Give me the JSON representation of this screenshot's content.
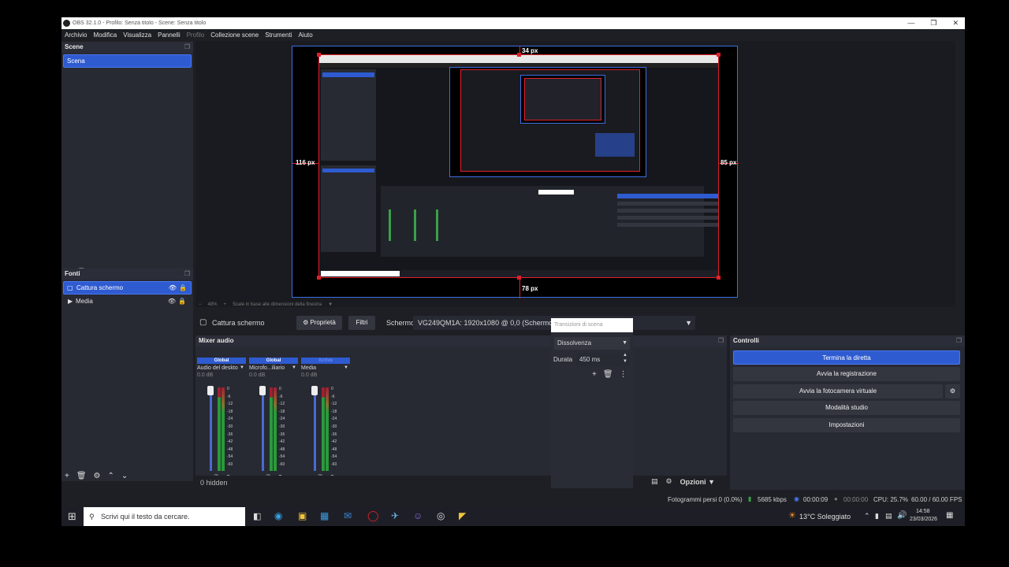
{
  "window": {
    "title": "OBS 32.1.0 - Profilo: Senza titolo - Scene: Senza titolo",
    "controls": [
      "minimize-icon",
      "restore-icon",
      "close-icon"
    ]
  },
  "menu": {
    "items": [
      "Archivio",
      "Modifica",
      "Visualizza",
      "Pannelli"
    ],
    "disabled": "Profilo",
    "items2": [
      "Collezione scene",
      "Strumenti",
      "Aiuto"
    ]
  },
  "scenes": {
    "title": "Scene",
    "items": [
      "Scena"
    ]
  },
  "sources": {
    "title": "Fonti",
    "items": [
      {
        "label": "Cattura schermo",
        "icon": "monitor-icon",
        "selected": true
      },
      {
        "label": "Media",
        "icon": "play-icon",
        "selected": false
      }
    ]
  },
  "preview": {
    "zoom": "48%",
    "scale_label": "Scale in base alle dimensioni della finestra",
    "px_top": "34 px",
    "px_left": "116 px",
    "px_right": "85 px",
    "px_bottom": "78 px"
  },
  "source_bar": {
    "source_name": "Cattura schermo",
    "properties": "Proprietà",
    "filters": "Filtri",
    "screen_label": "Schermo",
    "screen_value": "VG249QM1A: 1920x1080 @ 0,0 (Schermo princip"
  },
  "mixer": {
    "title": "Mixer audio",
    "hidden": "0 hidden",
    "channels": [
      {
        "tag": "Global",
        "name": "Audio del deskto",
        "db": "0.0 dB"
      },
      {
        "tag": "Global",
        "name": "Microfo...iliario",
        "db": "0.0 dB"
      },
      {
        "tag": "Active",
        "name": "Media",
        "db": "0.0 dB"
      }
    ],
    "scale": [
      "0",
      "-6",
      "-12",
      "-18",
      "-24",
      "-30",
      "-36",
      "-42",
      "-48",
      "-54",
      "-60"
    ]
  },
  "transitions": {
    "placeholder": "Transizioni di scena",
    "selected": "Dissolvenza",
    "duration_label": "Durata",
    "duration_value": "450 ms"
  },
  "bottom_toolbar": {
    "options": "Opzioni"
  },
  "controls": {
    "title": "Controlli",
    "stop_stream": "Termina la diretta",
    "start_recording": "Avvia la registrazione",
    "start_virtualcam": "Avvia la fotocamera virtuale",
    "studio_mode": "Modalità studio",
    "settings": "Impostazioni"
  },
  "status": {
    "dropped": "Fotogrammi persi 0 (0.0%)",
    "bitrate": "5685 kbps",
    "stream_time": "00:00:09",
    "rec_time": "00:00:00",
    "cpu": "CPU: 25.7%",
    "fps": "60.00 / 60.00 FPS"
  },
  "taskbar": {
    "search_placeholder": "Scrivi qui il testo da cercare.",
    "weather": "13°C  Soleggiato",
    "time": "14:58",
    "date": "23/03/2026"
  },
  "colors": {
    "accent": "#2f5bd1",
    "selection_border": "#e0202a",
    "preview_border": "#3c6fe0"
  }
}
